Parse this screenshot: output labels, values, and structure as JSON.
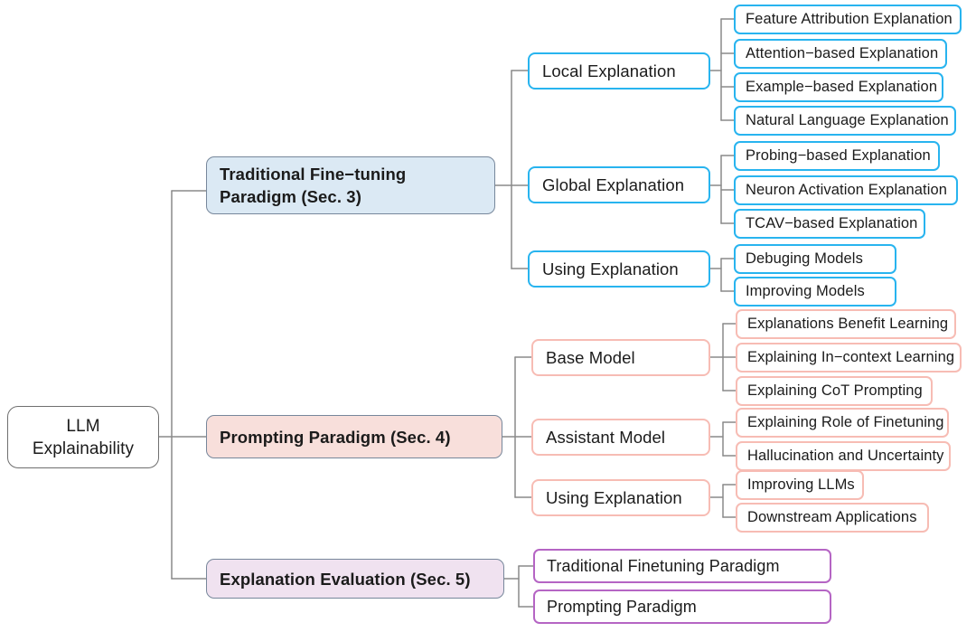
{
  "diagram": {
    "title": "LLM Explainability taxonomy mind map",
    "colors": {
      "blue_fill": "#dbe9f4",
      "blue_border": "#28b4ef",
      "pink_fill": "#f8dfdb",
      "pink_border": "#f7bcb4",
      "purple_fill": "#f0e2f0",
      "purple_border": "#b565c4",
      "neutral_border": "#77879b",
      "connector": "#8a8a8a",
      "text": "#1b1b1b"
    },
    "root": {
      "line1": "LLM",
      "line2": "Explainability"
    },
    "branches": [
      {
        "id": "traditional",
        "label": "Traditional Fine−tuning Paradigm (Sec. 3)",
        "label_line1": "Traditional Fine−tuning",
        "label_line2": "Paradigm (Sec. 3)",
        "theme": "blue",
        "categories": [
          {
            "id": "local-explanation",
            "label": "Local Explanation",
            "leaves": [
              "Feature Attribution Explanation",
              "Attention−based Explanation",
              "Example−based Explanation",
              "Natural Language Explanation"
            ]
          },
          {
            "id": "global-explanation",
            "label": "Global Explanation",
            "leaves": [
              "Probing−based Explanation",
              "Neuron Activation Explanation",
              "TCAV−based Explanation"
            ]
          },
          {
            "id": "using-explanation-traditional",
            "label": "Using Explanation",
            "leaves": [
              "Debuging Models",
              "Improving Models"
            ]
          }
        ]
      },
      {
        "id": "prompting",
        "label": "Prompting Paradigm (Sec. 4)",
        "theme": "pink",
        "categories": [
          {
            "id": "base-model",
            "label": "Base Model",
            "leaves": [
              "Explanations Benefit Learning",
              "Explaining In−context Learning",
              "Explaining CoT Prompting"
            ]
          },
          {
            "id": "assistant-model",
            "label": "Assistant Model",
            "leaves": [
              "Explaining Role of Finetuning",
              "Hallucination and Uncertainty"
            ]
          },
          {
            "id": "using-explanation-prompting",
            "label": "Using Explanation",
            "leaves": [
              "Improving LLMs",
              "Downstream Applications"
            ]
          }
        ]
      },
      {
        "id": "evaluation",
        "label": "Explanation Evaluation (Sec. 5)",
        "theme": "purple",
        "categories": [],
        "leaves": [
          "Traditional Finetuning Paradigm",
          "Prompting Paradigm"
        ]
      }
    ]
  }
}
